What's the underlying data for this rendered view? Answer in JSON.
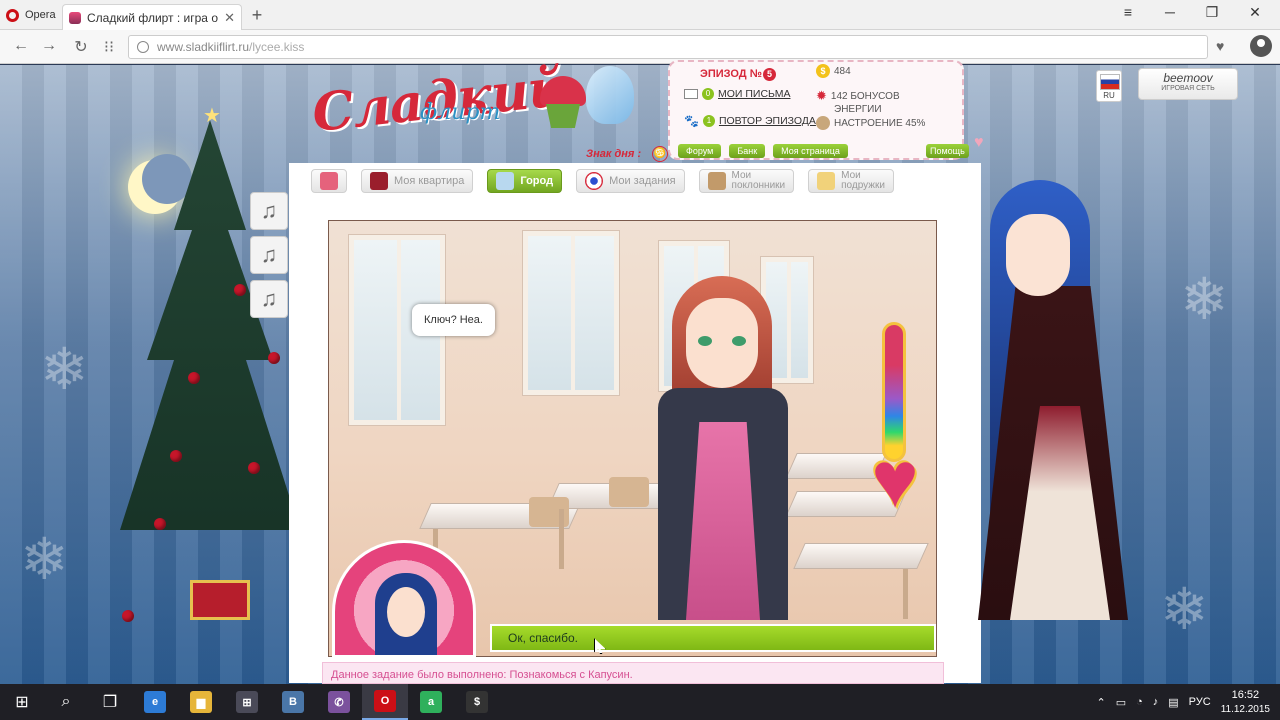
{
  "browser": {
    "menu_label": "Opera",
    "tab_title": "Сладкий флирт : игра о л",
    "tab_close": "✕",
    "new_tab": "+",
    "url_host": "www.sladkiiflirt.ru",
    "url_path": "/lycee.kiss",
    "controls": {
      "minimize": "─",
      "restore": "❐",
      "close": "✕",
      "menu": "≡"
    }
  },
  "site": {
    "logo_text": "Сладкий",
    "logo_sub": "флирт",
    "sign_of_day": "Знак дня :",
    "sign_icon": "♋",
    "lang": "RU",
    "network_brand": "beemoov",
    "network_label": "ИГРОВАЯ СЕТЬ"
  },
  "stats": {
    "episode_label": "ЭПИЗОД №",
    "episode_number": "5",
    "letters_count": "0",
    "letters_label": "МОИ ПИСЬМА",
    "repeat_count": "1",
    "repeat_label": "ПОВТОР ЭПИЗОДА",
    "coins": "484",
    "bonus": "142 БОНУСОВ",
    "energy": "ЭНЕРГИИ",
    "mood": "НАСТРОЕНИЕ 45%",
    "buttons": [
      "Форум",
      "Банк",
      "Моя страница"
    ],
    "help": "Помощь"
  },
  "nav": {
    "home": "",
    "apartment": "Моя квартира",
    "city": "Город",
    "tasks": "Мои задания",
    "admirers_1": "Мои",
    "admirers_2": "поклонники",
    "friends_1": "Мои",
    "friends_2": "подружки"
  },
  "game": {
    "speech": "Ключ? Нea.",
    "answer": "Ок, спасибо.",
    "notice": "Данное задание было выполнено: Познакомься с Капусин.",
    "love_meter_fraction": 0.62
  },
  "music": [
    "♫",
    "♫",
    "♫"
  ],
  "taskbar": {
    "lang": "РУС",
    "time": "16:52",
    "date": "11.12.2015",
    "apps": [
      {
        "name": "edge",
        "label": "e",
        "color": "#2d7bd6"
      },
      {
        "name": "explorer",
        "label": "▆",
        "color": "#e6b53a"
      },
      {
        "name": "store",
        "label": "⊞",
        "color": "#4a4a58"
      },
      {
        "name": "vk",
        "label": "В",
        "color": "#4a76a8"
      },
      {
        "name": "viber",
        "label": "✆",
        "color": "#7b519d"
      },
      {
        "name": "opera",
        "label": "O",
        "color": "#cc0f16"
      },
      {
        "name": "antivirus",
        "label": "a",
        "color": "#2fb05c"
      },
      {
        "name": "app-s",
        "label": "$",
        "color": "#333"
      }
    ]
  }
}
